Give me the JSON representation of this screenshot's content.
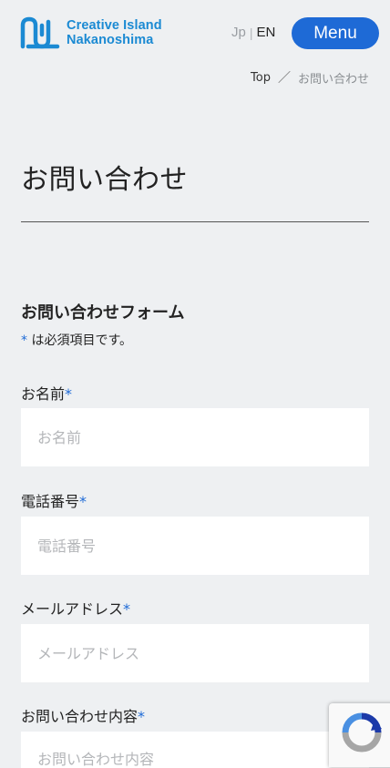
{
  "header": {
    "logo_line1": "Creative Island",
    "logo_line2": "Nakanoshima",
    "lang_jp": "Jp",
    "lang_sep": "|",
    "lang_en": "EN",
    "menu_label": "Menu"
  },
  "breadcrumb": {
    "top": "Top",
    "separator": "／",
    "current": "お問い合わせ"
  },
  "page": {
    "title": "お問い合わせ"
  },
  "form": {
    "heading": "お問い合わせフォーム",
    "required_mark": "*",
    "required_note": "は必須項目です。",
    "fields": [
      {
        "label": "お名前",
        "placeholder": "お名前"
      },
      {
        "label": "電話番号",
        "placeholder": "電話番号"
      },
      {
        "label": "メールアドレス",
        "placeholder": "メールアドレス"
      },
      {
        "label": "お問い合わせ内容",
        "placeholder": "お問い合わせ内容"
      }
    ]
  },
  "colors": {
    "brand_blue": "#1b8ad3",
    "accent_blue": "#1e6ad6",
    "background": "#eef0f2"
  },
  "icons": {
    "logo": "creative-island-logo-mark",
    "recaptcha": "recaptcha-icon"
  }
}
